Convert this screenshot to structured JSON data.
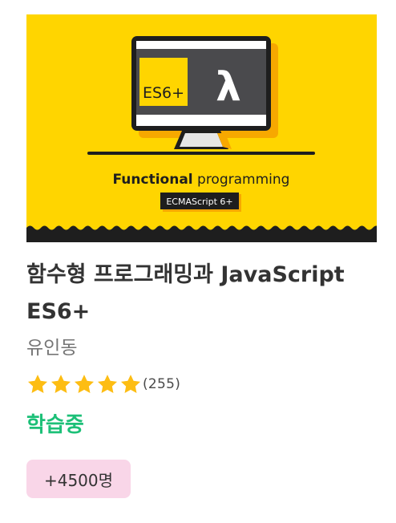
{
  "course": {
    "thumbnail": {
      "badge_text": "ES6+",
      "lambda_glyph": "λ",
      "headline_bold": "Functional",
      "headline_rest": " programming",
      "tag_text": "ECMAScript 6+",
      "colors": {
        "background": "#FFD500",
        "screen": "#4A4A4D",
        "accent": "#F7A800",
        "dark": "#1E1E1E"
      }
    },
    "title": "함수형 프로그래밍과 JavaScript ES6+",
    "instructor": "유인동",
    "rating": {
      "stars": 5,
      "count_text": "(255)"
    },
    "status": "학습중",
    "students_badge": "+4500명",
    "colors": {
      "status": "#1DC078",
      "badge_bg": "#F9D6E8",
      "star": "#FDBD13"
    }
  }
}
